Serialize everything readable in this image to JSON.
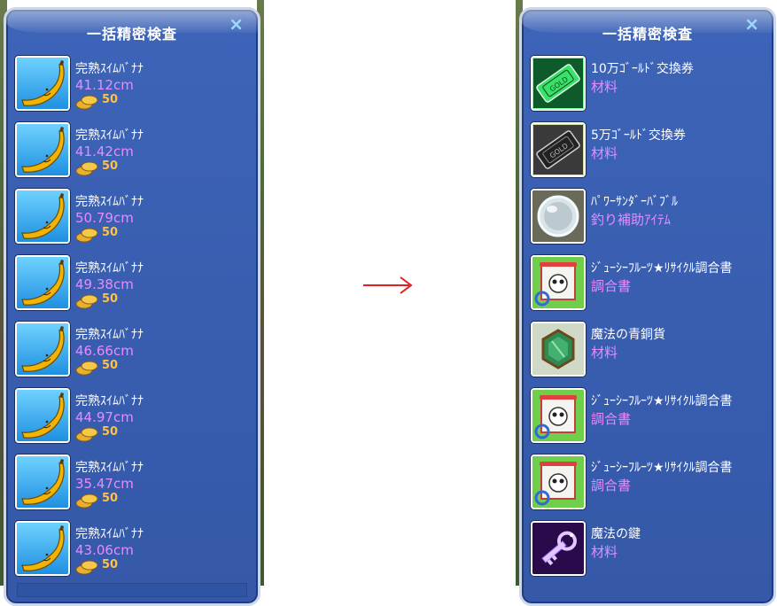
{
  "left_panel": {
    "title": "一括精密検査",
    "close_label": "×",
    "items": [
      {
        "name": "完熟ｽｲﾑﾊﾞﾅﾅ",
        "size": "41.12cm",
        "price": "50",
        "icon": "banana-icon"
      },
      {
        "name": "完熟ｽｲﾑﾊﾞﾅﾅ",
        "size": "41.42cm",
        "price": "50",
        "icon": "banana-icon"
      },
      {
        "name": "完熟ｽｲﾑﾊﾞﾅﾅ",
        "size": "50.79cm",
        "price": "50",
        "icon": "banana-icon"
      },
      {
        "name": "完熟ｽｲﾑﾊﾞﾅﾅ",
        "size": "49.38cm",
        "price": "50",
        "icon": "banana-icon"
      },
      {
        "name": "完熟ｽｲﾑﾊﾞﾅﾅ",
        "size": "46.66cm",
        "price": "50",
        "icon": "banana-icon"
      },
      {
        "name": "完熟ｽｲﾑﾊﾞﾅﾅ",
        "size": "44.97cm",
        "price": "50",
        "icon": "banana-icon"
      },
      {
        "name": "完熟ｽｲﾑﾊﾞﾅﾅ",
        "size": "35.47cm",
        "price": "50",
        "icon": "banana-icon"
      },
      {
        "name": "完熟ｽｲﾑﾊﾞﾅﾅ",
        "size": "43.06cm",
        "price": "50",
        "icon": "banana-icon"
      }
    ]
  },
  "arrow_label": "→",
  "right_panel": {
    "title": "一括精密検査",
    "close_label": "×",
    "items": [
      {
        "name": "10万ｺﾞｰﾙﾄﾞ交換券",
        "category": "材料",
        "icon": "gold-ticket-green-icon"
      },
      {
        "name": "5万ｺﾞｰﾙﾄﾞ交換券",
        "category": "材料",
        "icon": "gold-ticket-dark-icon"
      },
      {
        "name": "ﾊﾟﾜｰｻﾝﾀﾞｰﾊﾞﾌﾞﾙ",
        "category": "釣り補助ｱｲﾃﾑ",
        "icon": "bubble-icon"
      },
      {
        "name": "ｼﾞｭｰｼｰﾌﾙｰﾂ★ﾘｻｲｸﾙ調合書",
        "category": "調合書",
        "icon": "recipe-scroll-icon"
      },
      {
        "name": "魔法の青銅貨",
        "category": "材料",
        "icon": "bronze-coin-icon"
      },
      {
        "name": "ｼﾞｭｰｼｰﾌﾙｰﾂ★ﾘｻｲｸﾙ調合書",
        "category": "調合書",
        "icon": "recipe-scroll-icon"
      },
      {
        "name": "ｼﾞｭｰｼｰﾌﾙｰﾂ★ﾘｻｲｸﾙ調合書",
        "category": "調合書",
        "icon": "recipe-scroll-icon"
      },
      {
        "name": "魔法の鍵",
        "category": "材料",
        "icon": "magic-key-icon"
      }
    ]
  },
  "colors": {
    "panel_bg": "#3558a8",
    "name_text": "#ffffff",
    "sub_text": "#e68cff",
    "price_text": "#ffc04a",
    "arrow": "#e02020"
  }
}
